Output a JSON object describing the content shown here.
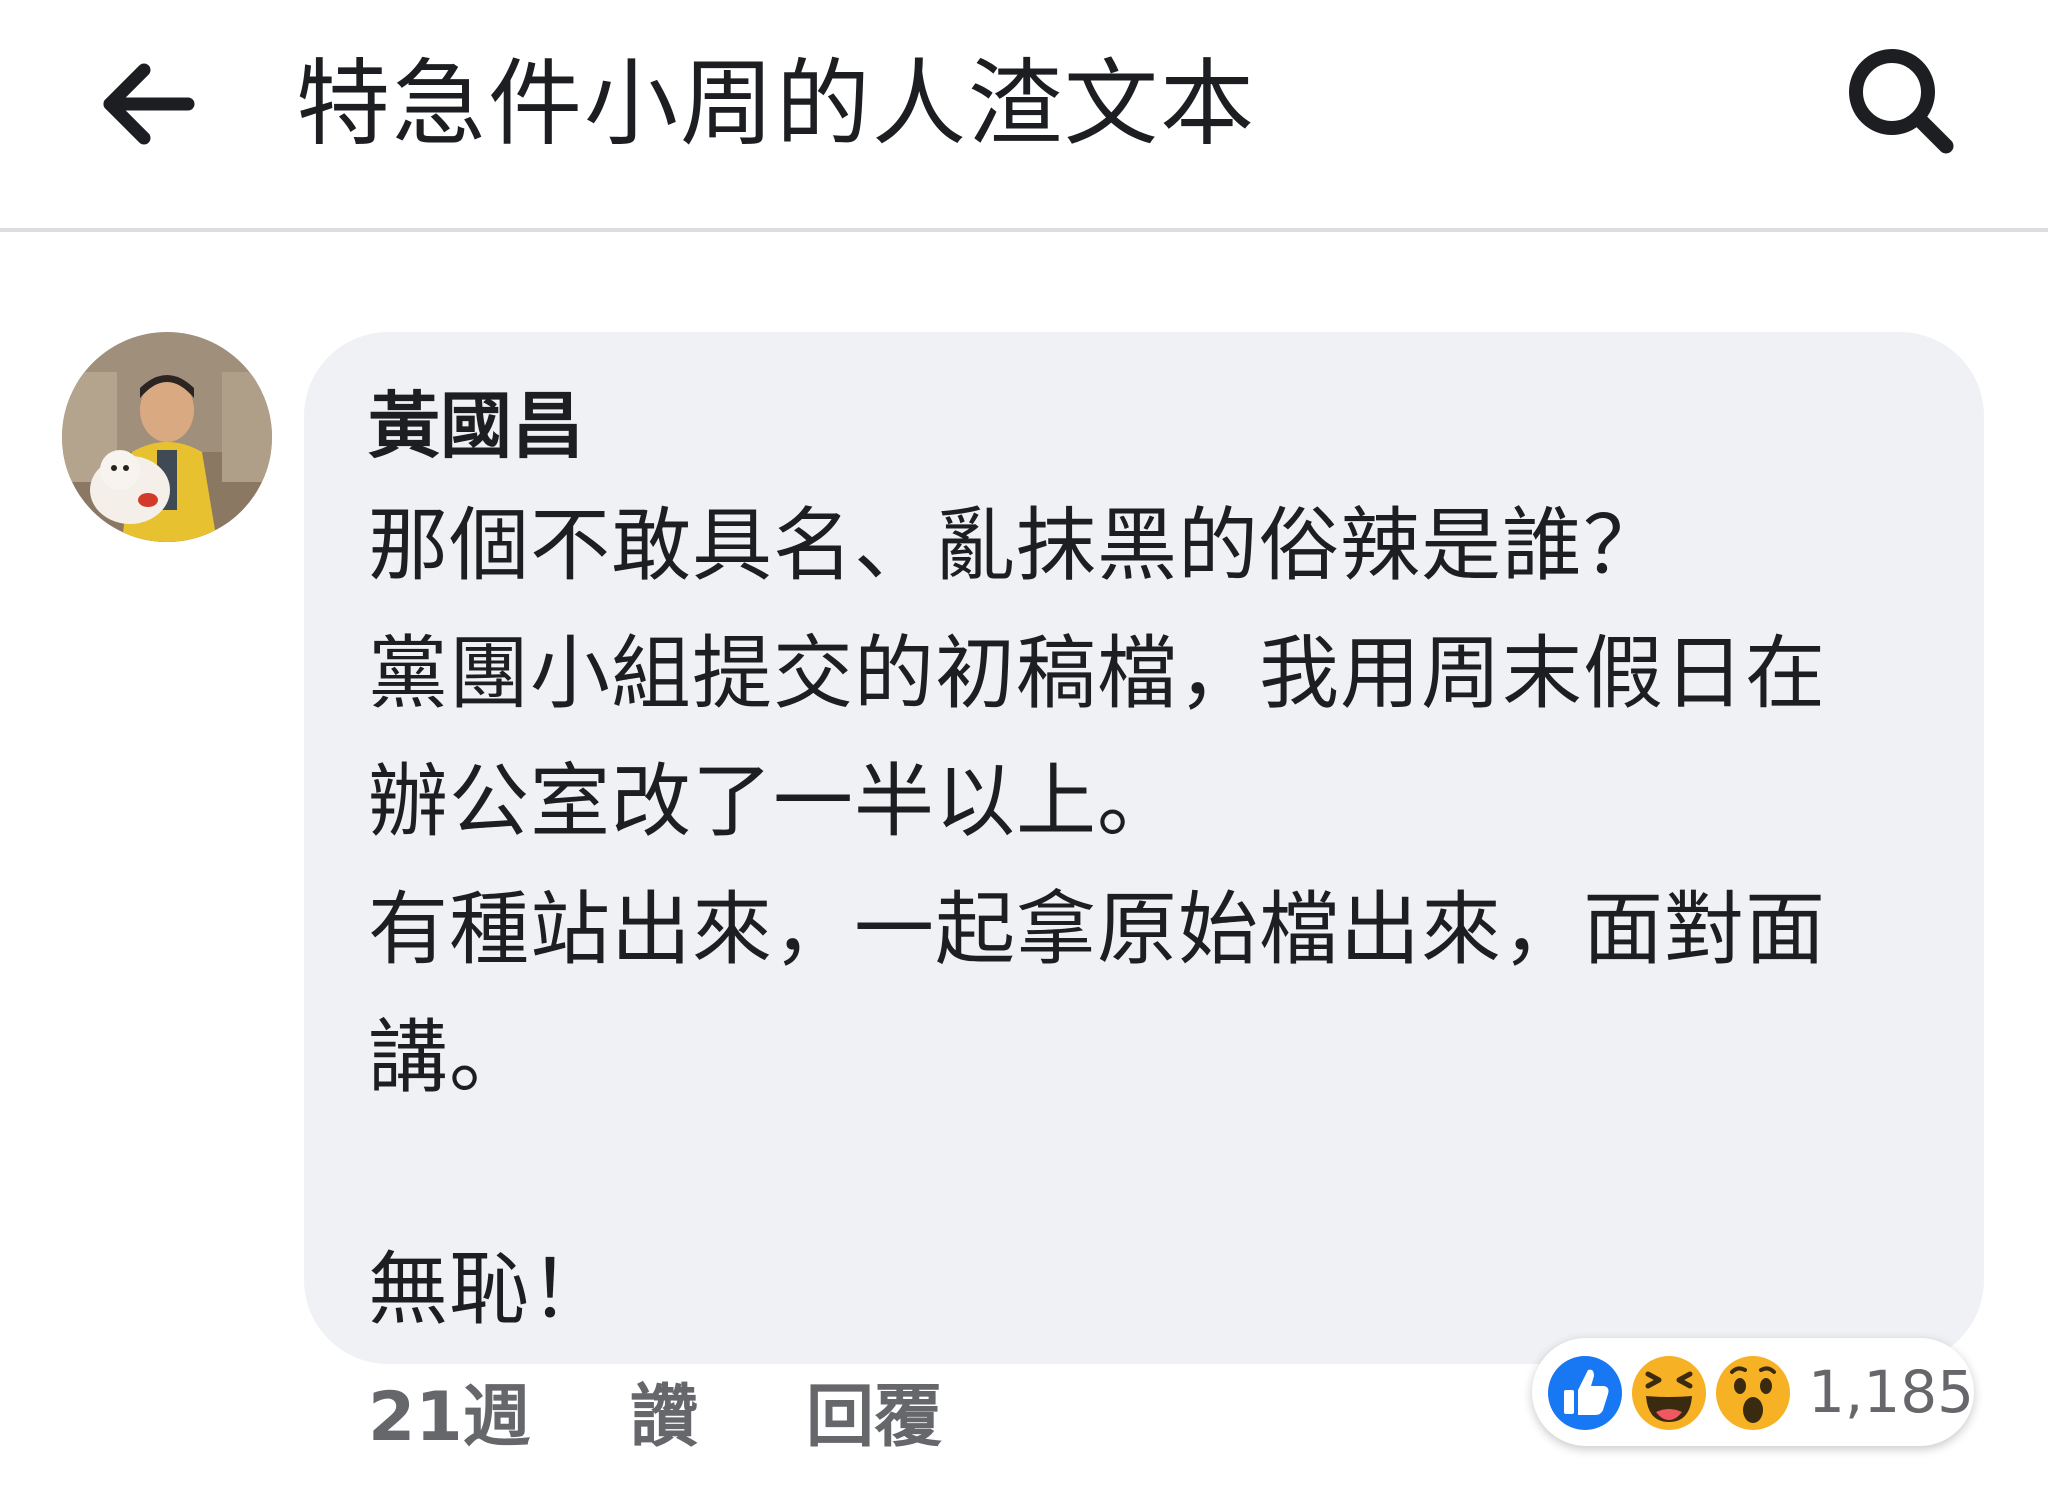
{
  "header": {
    "back_icon": "arrow-left-icon",
    "title": "特急件小周的人渣文本",
    "search_icon": "search-icon"
  },
  "comment": {
    "author": "黃國昌",
    "avatar": "avatar-photo",
    "lines": [
      "那個不敢具名、亂抹黑的俗辣是誰？",
      "黨團小組提交的初稿檔，我用周末假日在",
      "辦公室改了一半以上。",
      "有種站出來，一起拿原始檔出來，面對面",
      "講。",
      "",
      "無恥！"
    ]
  },
  "actions": {
    "time": "21週",
    "like": "讚",
    "reply": "回覆"
  },
  "reactions": {
    "icons": [
      "like-icon",
      "haha-icon",
      "wow-icon"
    ],
    "count": "1,185"
  },
  "colors": {
    "bubble": "#f0f1f5",
    "text": "#1c1e21",
    "secondary": "#65676b",
    "like_blue": "#1877f2",
    "reaction_yellow": "#f7b125"
  }
}
